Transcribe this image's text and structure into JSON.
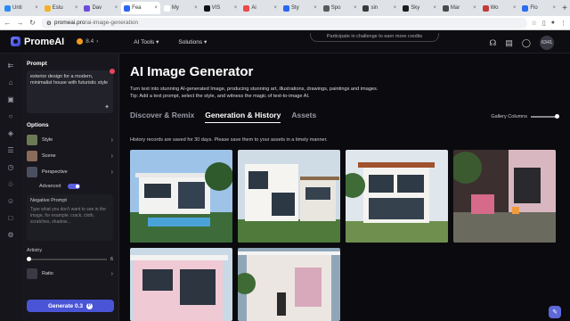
{
  "browser": {
    "tabs": [
      {
        "label": "Unti",
        "color": "#2a8bf2"
      },
      {
        "label": "Estu",
        "color": "#f2b12a"
      },
      {
        "label": "Dav",
        "color": "#6b4fd8"
      },
      {
        "label": "Fea",
        "color": "#2a66f2",
        "active": true
      },
      {
        "label": "My",
        "color": "#ffffff"
      },
      {
        "label": "VIS",
        "color": "#111111"
      },
      {
        "label": "Ai",
        "color": "#ea4a4a"
      },
      {
        "label": "Sty",
        "color": "#2a66f2"
      },
      {
        "label": "Spo",
        "color": "#5a5a5a"
      },
      {
        "label": "sin",
        "color": "#3a3a3a"
      },
      {
        "label": "Sky",
        "color": "#1b1b1b"
      },
      {
        "label": "Mar",
        "color": "#4a4a4a"
      },
      {
        "label": "Wo",
        "color": "#c23b3b"
      },
      {
        "label": "Flo",
        "color": "#2a6ef2"
      }
    ],
    "new_tab": "+",
    "url_domain": "promeai.pro",
    "url_path": "/ai-image-generation"
  },
  "header": {
    "brand": "PromeAI",
    "credits": "8.4",
    "nav": [
      "AI Tools",
      "Solutions"
    ],
    "banner": "Participate in challenge to earn more credits",
    "avatar": "6341"
  },
  "panel": {
    "prompt_title": "Prompt",
    "prompt_text": "exterior design for a modern, minimalist house with futuristic style",
    "options_title": "Options",
    "options": [
      {
        "label": "Style",
        "color": "#6b7a55"
      },
      {
        "label": "Scene",
        "color": "#8a6a5a"
      },
      {
        "label": "Perspective",
        "color": "#4a4f60"
      }
    ],
    "advanced_label": "Advanced",
    "negative_title": "Negative Prompt",
    "negative_placeholder": "Type what you don't want to see in the image, for example: crack, cloth, scratches, shadow...",
    "artistry_label": "Artistry",
    "artistry_value": "6",
    "ratio_label": "Ratio",
    "generate_label": "Generate 0.3"
  },
  "main": {
    "title": "AI Image Generator",
    "sub1": "Turn text into stunning AI-generated Image, producing stunning art, illustrations, drawings, paintings and images.",
    "sub2": "Tip: Add a text prompt, select the style, and witness the magic of text-to-image AI.",
    "tabs": [
      "Discover & Remix",
      "Generation & History",
      "Assets"
    ],
    "gallery_columns": "Gallery Columns",
    "history_note": "History records are saved for 30 days. Please save them to your assets in a timely manner."
  }
}
